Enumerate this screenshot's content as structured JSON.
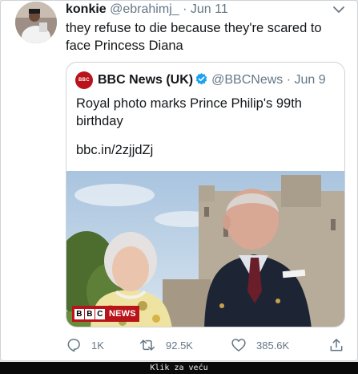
{
  "tweet": {
    "author_name": "konkie",
    "author_handle": "@ebrahimj_",
    "separator": "·",
    "date": "Jun 11",
    "text": "they refuse to die because they're scared to face Princess Diana"
  },
  "quoted": {
    "logo_text": "BBC NEWS",
    "author_name": "BBC News (UK)",
    "author_handle": "@BBCNews",
    "separator": "·",
    "date": "Jun 9",
    "text": "Royal photo marks Prince Philip's 99th birthday",
    "link": "bbc.in/2zjjdZj",
    "photo_badge": {
      "letters": [
        "B",
        "B",
        "C"
      ],
      "label": "NEWS"
    }
  },
  "actions": {
    "reply_count": "1K",
    "retweet_count": "92.5K",
    "like_count": "385.6K"
  },
  "footer": {
    "label": "Klik za veću"
  },
  "colors": {
    "bbc_red": "#b8141a",
    "verified_blue": "#1da1f2",
    "secondary_text": "#657786"
  },
  "icons": {
    "reply": "speech-bubble-icon",
    "retweet": "retweet-arrows-icon",
    "like": "heart-icon",
    "share": "share-upload-icon",
    "more": "chevron-down-icon"
  }
}
